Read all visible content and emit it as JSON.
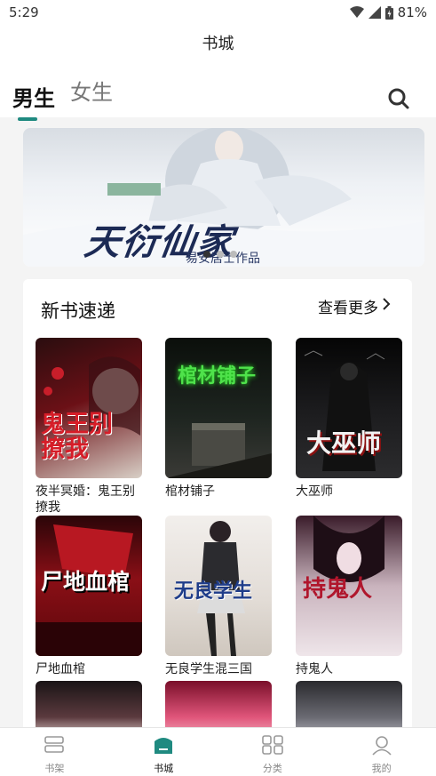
{
  "status_bar": {
    "time": "5:29",
    "battery": "81%"
  },
  "header": {
    "title": "书城"
  },
  "tabs": [
    {
      "label": "男生",
      "active": true
    },
    {
      "label": "女生",
      "active": false
    }
  ],
  "banner": {
    "title": "天衍仙家",
    "author": "易安居士作品",
    "dot_count": 3,
    "active_dot": 0
  },
  "section": {
    "title": "新书速递",
    "more_label": "查看更多",
    "books": [
      {
        "title": "夜半冥婚：鬼王别撩我",
        "cover_text": "鬼王别撩我"
      },
      {
        "title": "棺材铺子",
        "cover_text": "棺材铺子"
      },
      {
        "title": "大巫师",
        "cover_text": "大巫师"
      },
      {
        "title": "尸地血棺",
        "cover_text": "尸地血棺"
      },
      {
        "title": "无良学生混三国",
        "cover_text": "无良学生"
      },
      {
        "title": "持鬼人",
        "cover_text": "持鬼人"
      }
    ]
  },
  "bottom_nav": [
    {
      "label": "书架",
      "icon": "bookshelf-icon",
      "active": false
    },
    {
      "label": "书城",
      "icon": "bookstore-icon",
      "active": true
    },
    {
      "label": "分类",
      "icon": "category-icon",
      "active": false
    },
    {
      "label": "我的",
      "icon": "profile-icon",
      "active": false
    }
  ],
  "colors": {
    "accent": "#1f8a80"
  }
}
